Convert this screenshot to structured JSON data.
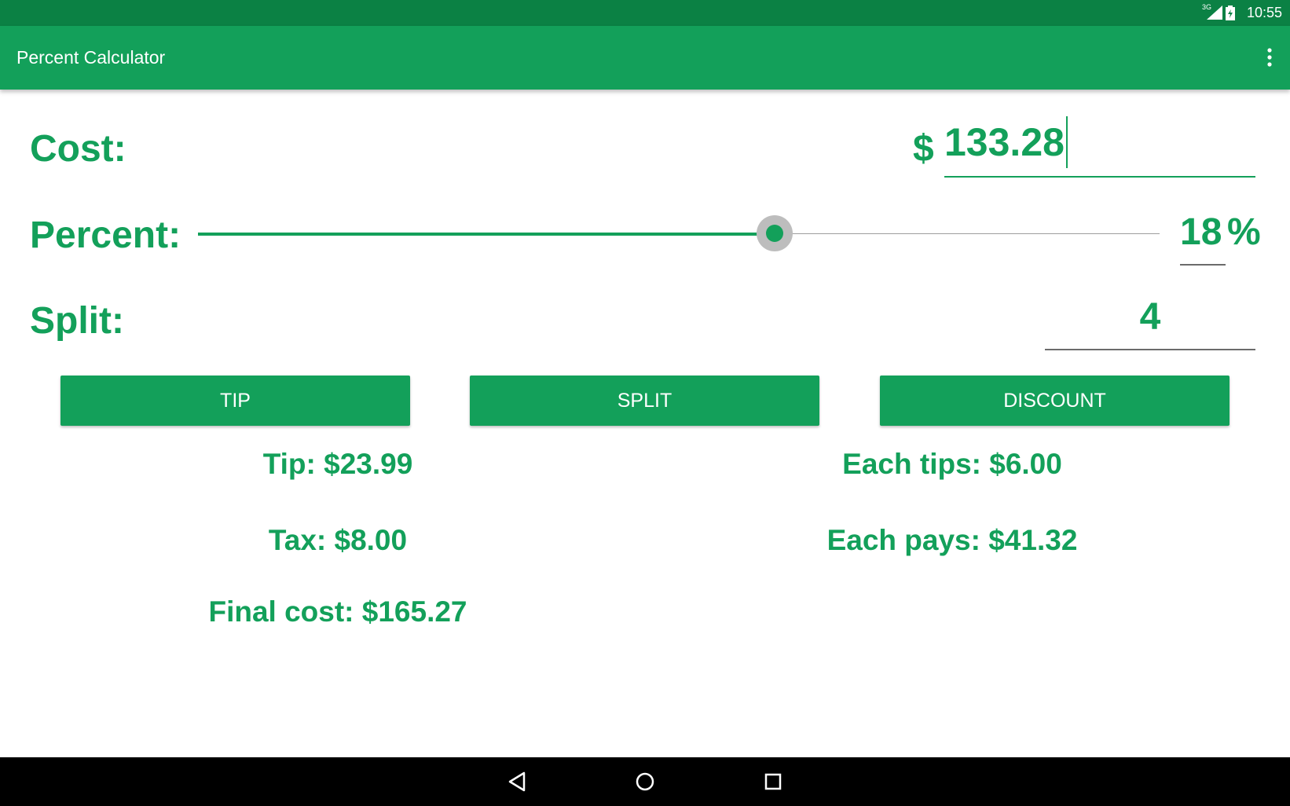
{
  "status_bar": {
    "time": "10:55",
    "network": "3G",
    "icons": [
      "signal-icon",
      "battery-icon"
    ]
  },
  "app_bar": {
    "title": "Percent Calculator",
    "menu_icon": "overflow-menu-icon"
  },
  "form": {
    "cost_label": "Cost:",
    "currency_symbol": "$",
    "cost_value": "133.28",
    "percent_label": "Percent:",
    "percent_value": "18",
    "percent_symbol": "%",
    "slider_fraction": 0.6,
    "split_label": "Split:",
    "split_value": "4"
  },
  "buttons": {
    "tip": "TIP",
    "split": "SPLIT",
    "discount": "DISCOUNT"
  },
  "results": {
    "tip": "Tip: $23.99",
    "tax": "Tax: $8.00",
    "final_cost": "Final cost: $165.27",
    "each_tips": "Each tips: $6.00",
    "each_pays": "Each pays: $41.32"
  },
  "colors": {
    "accent": "#13a05a",
    "status_bar": "#0b8144",
    "nav_bar": "#000000"
  },
  "nav_bar": {
    "icons": [
      "back-icon",
      "home-icon",
      "recents-icon"
    ]
  }
}
